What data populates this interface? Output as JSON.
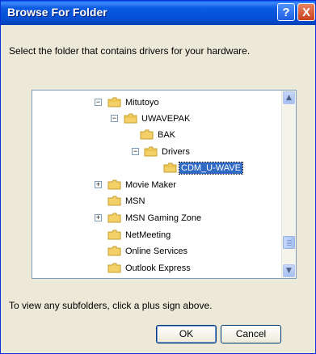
{
  "window": {
    "title": "Browse For Folder",
    "help_label": "?",
    "close_label": "X"
  },
  "instruction": "Select the folder that contains drivers for your hardware.",
  "tree": {
    "items": [
      {
        "label": "Mitutoyo",
        "expander": "−",
        "selected": false
      },
      {
        "label": "UWAVEPAK",
        "expander": "−",
        "selected": false
      },
      {
        "label": "BAK",
        "expander": "",
        "selected": false
      },
      {
        "label": "Drivers",
        "expander": "−",
        "selected": false
      },
      {
        "label": "CDM_U-WAVE",
        "expander": "",
        "selected": true
      },
      {
        "label": "Movie Maker",
        "expander": "+",
        "selected": false
      },
      {
        "label": "MSN",
        "expander": "",
        "selected": false
      },
      {
        "label": "MSN Gaming Zone",
        "expander": "+",
        "selected": false
      },
      {
        "label": "NetMeeting",
        "expander": "",
        "selected": false
      },
      {
        "label": "Online Services",
        "expander": "",
        "selected": false
      },
      {
        "label": "Outlook Express",
        "expander": "",
        "selected": false
      }
    ]
  },
  "hint": "To view any subfolders, click a plus sign above.",
  "buttons": {
    "ok": "OK",
    "cancel": "Cancel"
  },
  "colors": {
    "selection": "#316ac5",
    "titlebar": "#0450d6",
    "folder": "#f3d168"
  }
}
